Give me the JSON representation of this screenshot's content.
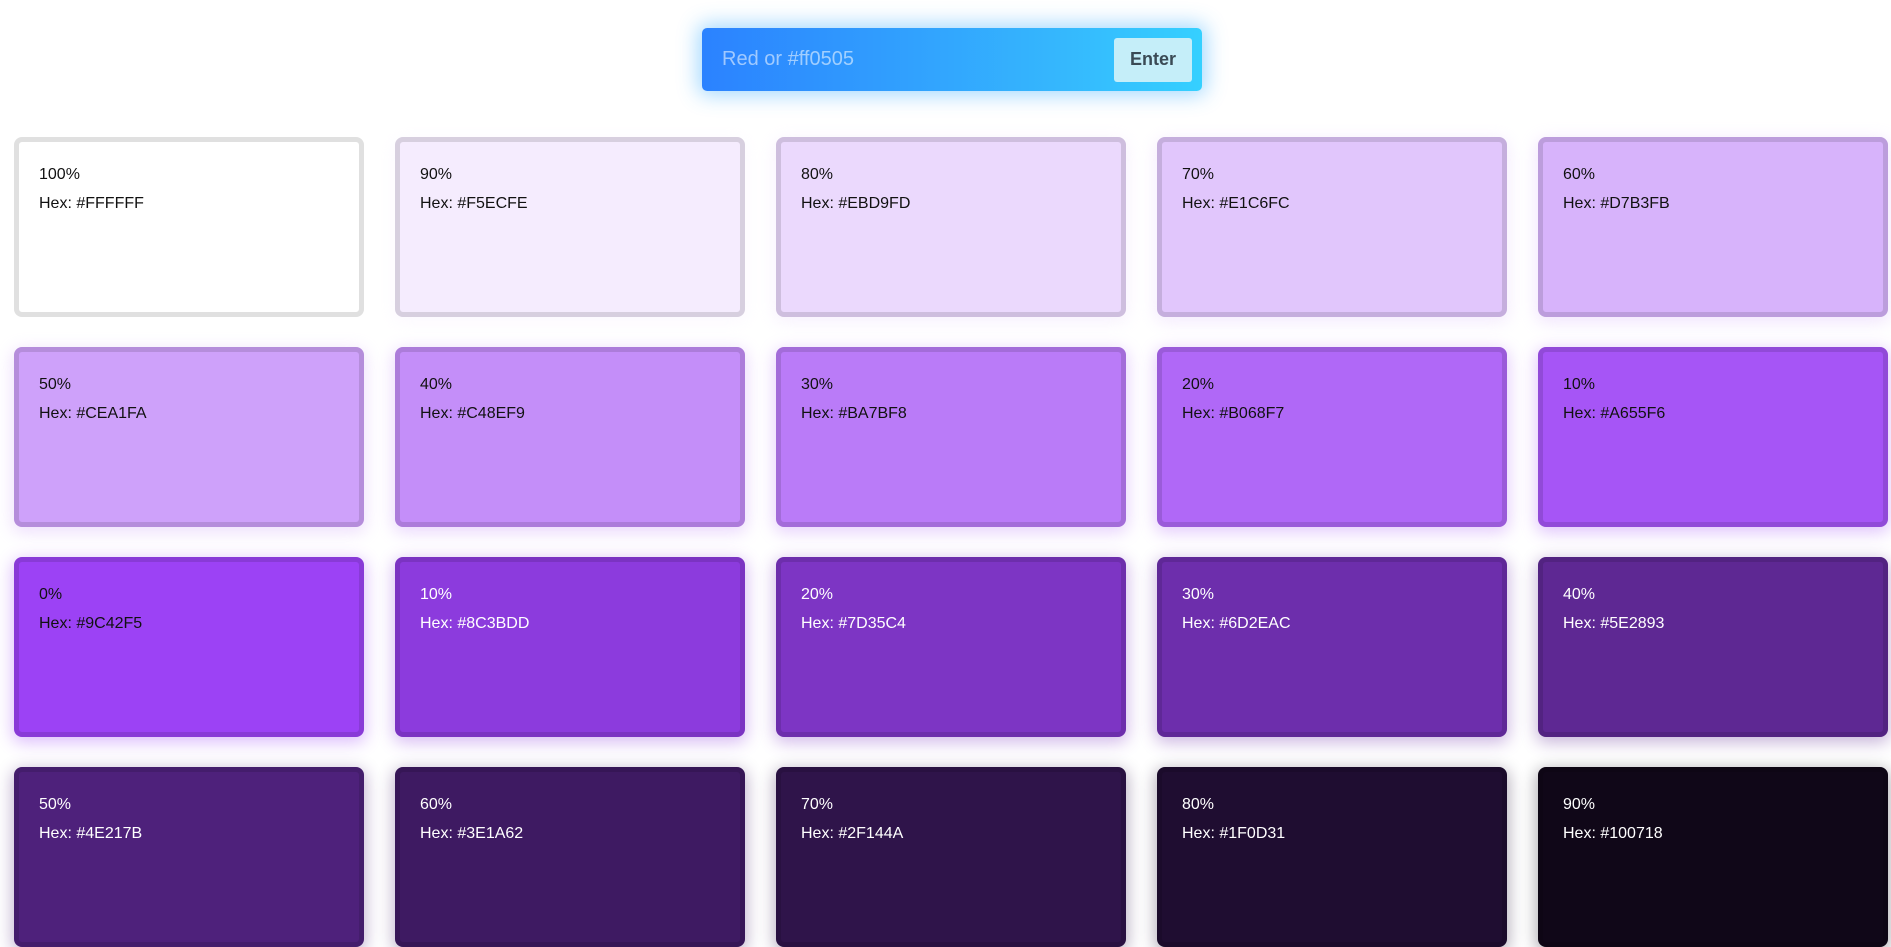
{
  "search": {
    "placeholder": "Red or #ff0505",
    "button_label": "Enter"
  },
  "swatches": [
    {
      "label": "100%",
      "hex_text": "Hex: #FFFFFF",
      "color": "#FFFFFF",
      "text_color": "#111111"
    },
    {
      "label": "90%",
      "hex_text": "Hex: #F5ECFE",
      "color": "#F5ECFE",
      "text_color": "#111111"
    },
    {
      "label": "80%",
      "hex_text": "Hex: #EBD9FD",
      "color": "#EBD9FD",
      "text_color": "#111111"
    },
    {
      "label": "70%",
      "hex_text": "Hex: #E1C6FC",
      "color": "#E1C6FC",
      "text_color": "#111111"
    },
    {
      "label": "60%",
      "hex_text": "Hex: #D7B3FB",
      "color": "#D7B3FB",
      "text_color": "#111111"
    },
    {
      "label": "50%",
      "hex_text": "Hex: #CEA1FA",
      "color": "#CEA1FA",
      "text_color": "#111111"
    },
    {
      "label": "40%",
      "hex_text": "Hex: #C48EF9",
      "color": "#C48EF9",
      "text_color": "#111111"
    },
    {
      "label": "30%",
      "hex_text": "Hex: #BA7BF8",
      "color": "#BA7BF8",
      "text_color": "#111111"
    },
    {
      "label": "20%",
      "hex_text": "Hex: #B068F7",
      "color": "#B068F7",
      "text_color": "#111111"
    },
    {
      "label": "10%",
      "hex_text": "Hex: #A655F6",
      "color": "#A655F6",
      "text_color": "#111111"
    },
    {
      "label": "0%",
      "hex_text": "Hex: #9C42F5",
      "color": "#9C42F5",
      "text_color": "#111111"
    },
    {
      "label": "10%",
      "hex_text": "Hex: #8C3BDD",
      "color": "#8C3BDD",
      "text_color": "#ffffff"
    },
    {
      "label": "20%",
      "hex_text": "Hex: #7D35C4",
      "color": "#7D35C4",
      "text_color": "#ffffff"
    },
    {
      "label": "30%",
      "hex_text": "Hex: #6D2EAC",
      "color": "#6D2EAC",
      "text_color": "#ffffff"
    },
    {
      "label": "40%",
      "hex_text": "Hex: #5E2893",
      "color": "#5E2893",
      "text_color": "#ffffff"
    },
    {
      "label": "50%",
      "hex_text": "Hex: #4E217B",
      "color": "#4E217B",
      "text_color": "#ffffff"
    },
    {
      "label": "60%",
      "hex_text": "Hex: #3E1A62",
      "color": "#3E1A62",
      "text_color": "#ffffff"
    },
    {
      "label": "70%",
      "hex_text": "Hex: #2F144A",
      "color": "#2F144A",
      "text_color": "#ffffff"
    },
    {
      "label": "80%",
      "hex_text": "Hex: #1F0D31",
      "color": "#1F0D31",
      "text_color": "#ffffff"
    },
    {
      "label": "90%",
      "hex_text": "Hex: #100718",
      "color": "#100718",
      "text_color": "#ffffff"
    }
  ]
}
